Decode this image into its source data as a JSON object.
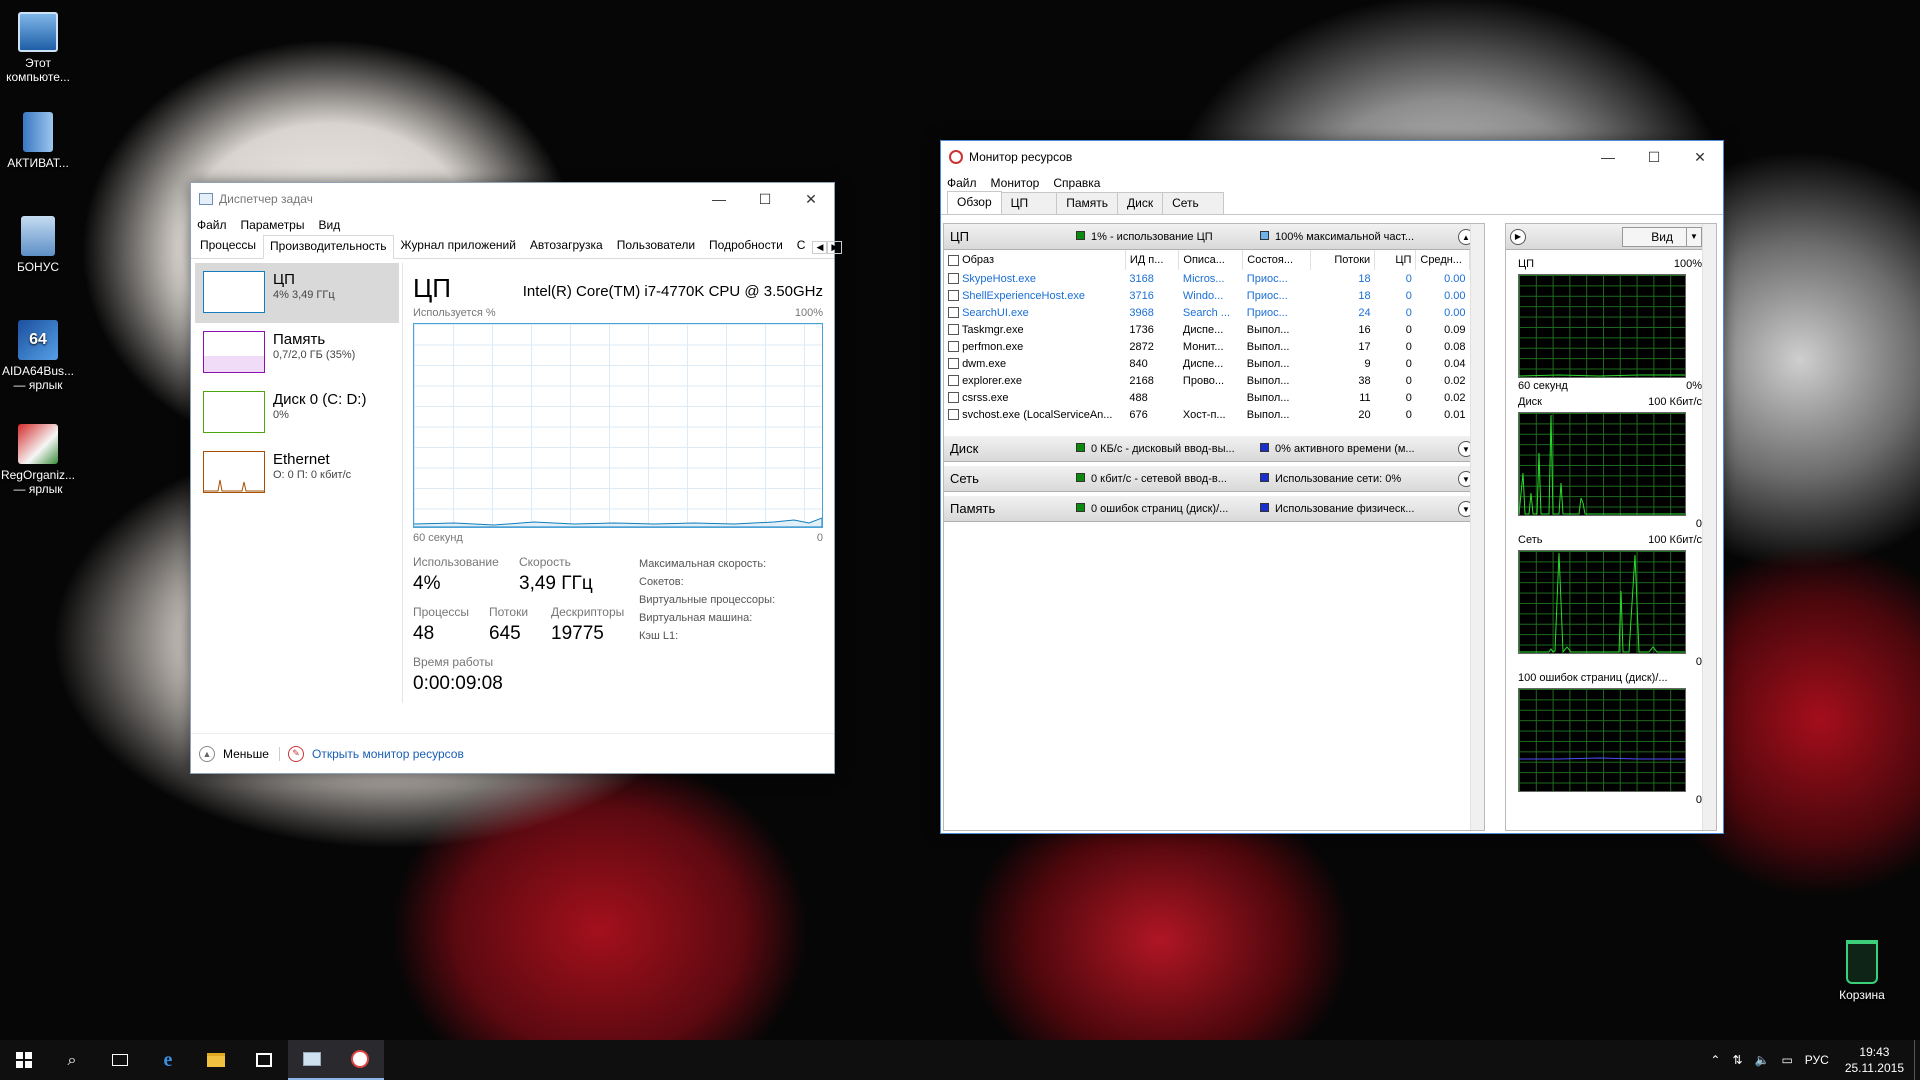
{
  "desktop": {
    "icons": [
      {
        "label": "Этот компьюте..."
      },
      {
        "label": "АКТИВАТ..."
      },
      {
        "label": "БОНУС"
      },
      {
        "label": "AIDA64Bus...",
        "sub": "— ярлык"
      },
      {
        "label": "RegOrganiz...",
        "sub": "— ярлык"
      }
    ],
    "recycle_label": "Корзина"
  },
  "task_manager": {
    "title": "Диспетчер задач",
    "menu": [
      "Файл",
      "Параметры",
      "Вид"
    ],
    "tabs": [
      "Процессы",
      "Производительность",
      "Журнал приложений",
      "Автозагрузка",
      "Пользователи",
      "Подробности",
      "С"
    ],
    "side": [
      {
        "name": "ЦП",
        "value": "4% 3,49 ГГц",
        "color": "#117dbb"
      },
      {
        "name": "Память",
        "value": "0,7/2,0 ГБ (35%)",
        "color": "#8b12ae"
      },
      {
        "name": "Диск 0 (C: D:)",
        "value": "0%",
        "color": "#4da60c"
      },
      {
        "name": "Ethernet",
        "value": "О: 0 П: 0 кбит/с",
        "color": "#a74f01"
      }
    ],
    "main": {
      "heading": "ЦП",
      "cpu_model": "Intel(R) Core(TM) i7-4770K CPU @ 3.50GHz",
      "graph_label": "Используется %",
      "graph_max": "100%",
      "graph_time": "60 секунд",
      "graph_min": "0",
      "usage_label": "Использование",
      "usage_value": "4%",
      "speed_label": "Скорость",
      "speed_value": "3,49 ГГц",
      "processes_label": "Процессы",
      "processes_value": "48",
      "threads_label": "Потоки",
      "threads_value": "645",
      "handles_label": "Дескрипторы",
      "handles_value": "19775",
      "uptime_label": "Время работы",
      "uptime_value": "0:00:09:08",
      "info": [
        "Максимальная скорость:",
        "Сокетов:",
        "Виртуальные процессоры:",
        "Виртуальная машина:",
        "Кэш L1:"
      ]
    },
    "footer": {
      "less": "Меньше",
      "open_rm": "Открыть монитор ресурсов"
    }
  },
  "resource_monitor": {
    "title": "Монитор ресурсов",
    "menu": [
      "Файл",
      "Монитор",
      "Справка"
    ],
    "tabs": [
      "Обзор",
      "ЦП",
      "Память",
      "Диск",
      "Сеть"
    ],
    "cpu_section": {
      "title": "ЦП",
      "metric1": "1% - использование ЦП",
      "metric2": "100% максимальной част..."
    },
    "columns": [
      "Образ",
      "ИД п...",
      "Описа...",
      "Состоя...",
      "Потоки",
      "ЦП",
      "Средн..."
    ],
    "processes": [
      {
        "name": "SkypeHost.exe",
        "pid": "3168",
        "desc": "Micros...",
        "state": "Приос...",
        "threads": "18",
        "cpu": "0",
        "avg": "0.00",
        "suspended": true
      },
      {
        "name": "ShellExperienceHost.exe",
        "pid": "3716",
        "desc": "Windo...",
        "state": "Приос...",
        "threads": "18",
        "cpu": "0",
        "avg": "0.00",
        "suspended": true
      },
      {
        "name": "SearchUI.exe",
        "pid": "3968",
        "desc": "Search ...",
        "state": "Приос...",
        "threads": "24",
        "cpu": "0",
        "avg": "0.00",
        "suspended": true
      },
      {
        "name": "Taskmgr.exe",
        "pid": "1736",
        "desc": "Диспе...",
        "state": "Выпол...",
        "threads": "16",
        "cpu": "0",
        "avg": "0.09",
        "suspended": false
      },
      {
        "name": "perfmon.exe",
        "pid": "2872",
        "desc": "Монит...",
        "state": "Выпол...",
        "threads": "17",
        "cpu": "0",
        "avg": "0.08",
        "suspended": false
      },
      {
        "name": "dwm.exe",
        "pid": "840",
        "desc": "Диспе...",
        "state": "Выпол...",
        "threads": "9",
        "cpu": "0",
        "avg": "0.04",
        "suspended": false
      },
      {
        "name": "explorer.exe",
        "pid": "2168",
        "desc": "Прово...",
        "state": "Выпол...",
        "threads": "38",
        "cpu": "0",
        "avg": "0.02",
        "suspended": false
      },
      {
        "name": "csrss.exe",
        "pid": "488",
        "desc": "",
        "state": "Выпол...",
        "threads": "11",
        "cpu": "0",
        "avg": "0.02",
        "suspended": false
      },
      {
        "name": "svchost.exe (LocalServiceAn...",
        "pid": "676",
        "desc": "Хост-п...",
        "state": "Выпол...",
        "threads": "20",
        "cpu": "0",
        "avg": "0.01",
        "suspended": false
      }
    ],
    "sections": [
      {
        "title": "Диск",
        "metric1": "0 КБ/с - дисковый ввод-вы...",
        "metric2": "0% активного времени (м..."
      },
      {
        "title": "Сеть",
        "metric1": "0 кбит/с - сетевой ввод-в...",
        "metric2": "Использование сети: 0%"
      },
      {
        "title": "Память",
        "metric1": "0 ошибок страниц (диск)/...",
        "metric2": "Использование физическ..."
      }
    ],
    "view_button": "Вид",
    "graphs": [
      {
        "title": "ЦП",
        "max": "100%",
        "bottom_left": "60 секунд",
        "bottom_right": "0%"
      },
      {
        "title": "Диск",
        "max": "100 Кбит/с",
        "bottom_right": "0"
      },
      {
        "title": "Сеть",
        "max": "100 Кбит/с",
        "bottom_right": "0"
      },
      {
        "title": "100 ошибок страниц (диск)/...",
        "max": "",
        "bottom_right": "0"
      }
    ]
  },
  "taskbar": {
    "lang": "РУС",
    "time": "19:43",
    "date": "25.11.2015"
  }
}
